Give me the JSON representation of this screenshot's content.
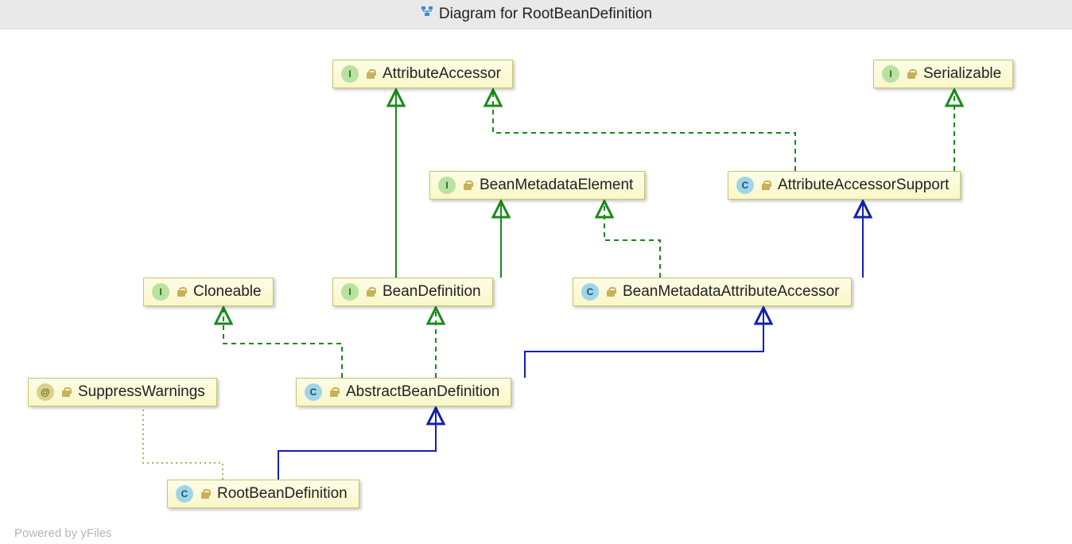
{
  "header": {
    "title": "Diagram for RootBeanDefinition"
  },
  "footer": {
    "text": "Powered by yFiles"
  },
  "nodes": {
    "attributeAccessor": {
      "label": "AttributeAccessor",
      "type": "I"
    },
    "serializable": {
      "label": "Serializable",
      "type": "I"
    },
    "beanMetadataElement": {
      "label": "BeanMetadataElement",
      "type": "I"
    },
    "attrAccessorSupport": {
      "label": "AttributeAccessorSupport",
      "type": "C"
    },
    "cloneable": {
      "label": "Cloneable",
      "type": "I"
    },
    "beanDefinition": {
      "label": "BeanDefinition",
      "type": "I"
    },
    "beanMetaAttrAccessor": {
      "label": "BeanMetadataAttributeAccessor",
      "type": "C"
    },
    "suppressWarnings": {
      "label": "SuppressWarnings",
      "type": "@"
    },
    "abstractBeanDefinition": {
      "label": "AbstractBeanDefinition",
      "type": "C"
    },
    "rootBeanDefinition": {
      "label": "RootBeanDefinition",
      "type": "C"
    }
  },
  "edges": [
    {
      "from": "beanDefinition",
      "to": "attributeAccessor",
      "kind": "implements"
    },
    {
      "from": "beanDefinition",
      "to": "beanMetadataElement",
      "kind": "implements"
    },
    {
      "from": "attrAccessorSupport",
      "to": "attributeAccessor",
      "kind": "implements"
    },
    {
      "from": "attrAccessorSupport",
      "to": "serializable",
      "kind": "implements"
    },
    {
      "from": "beanMetaAttrAccessor",
      "to": "beanMetadataElement",
      "kind": "implements"
    },
    {
      "from": "beanMetaAttrAccessor",
      "to": "attrAccessorSupport",
      "kind": "extends"
    },
    {
      "from": "abstractBeanDefinition",
      "to": "cloneable",
      "kind": "implements"
    },
    {
      "from": "abstractBeanDefinition",
      "to": "beanDefinition",
      "kind": "implements"
    },
    {
      "from": "abstractBeanDefinition",
      "to": "beanMetaAttrAccessor",
      "kind": "extends"
    },
    {
      "from": "rootBeanDefinition",
      "to": "abstractBeanDefinition",
      "kind": "extends"
    },
    {
      "from": "rootBeanDefinition",
      "to": "suppressWarnings",
      "kind": "annotation"
    }
  ]
}
